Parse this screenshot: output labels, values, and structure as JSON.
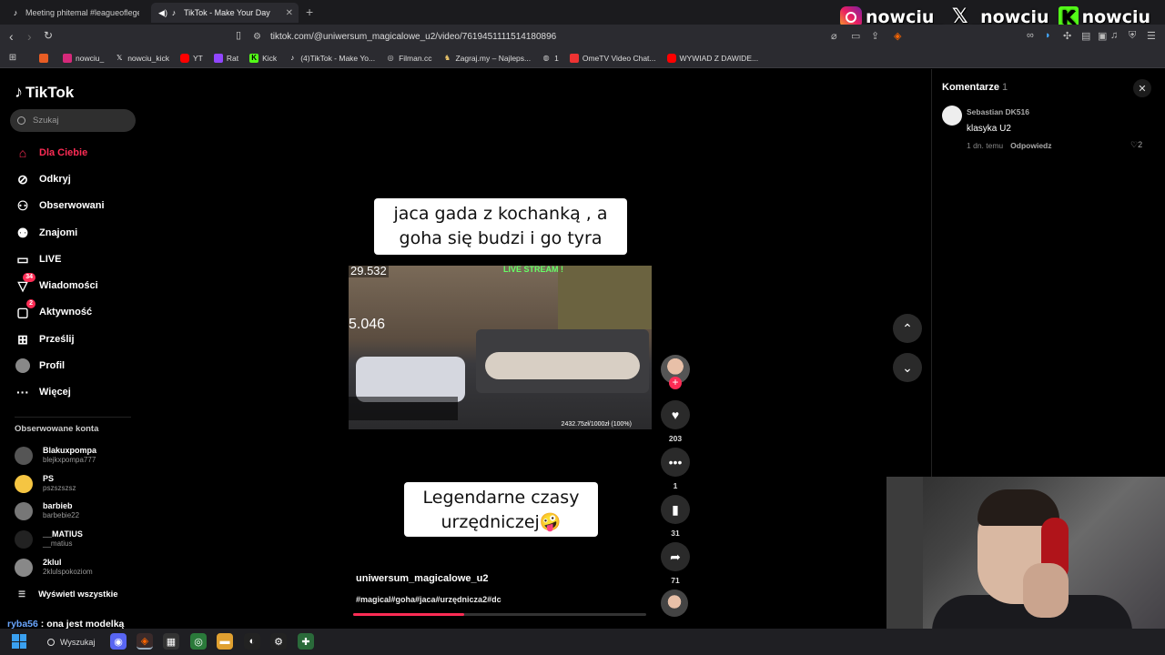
{
  "browser": {
    "tabs": [
      {
        "title": "Meeting phitemal #leagueoflegends"
      },
      {
        "title": "TikTok - Make Your Day"
      }
    ],
    "url": "tiktok.com/@uniwersum_magicalowe_u2/video/7619451111514180896",
    "bookmarks": [
      {
        "label": "nowciu_",
        "icon": "instagram-icon"
      },
      {
        "label": "nowciu_kick",
        "icon": "x-icon"
      },
      {
        "label": "YT",
        "icon": "youtube-icon"
      },
      {
        "label": "Rat",
        "icon": "twitch-icon"
      },
      {
        "label": "Kick",
        "icon": "kick-icon"
      },
      {
        "label": "(4)TikTok - Make Yo...",
        "icon": "tiktok-icon"
      },
      {
        "label": "Filman.cc",
        "icon": "filman-icon"
      },
      {
        "label": "Zagraj.my – Najleps...",
        "icon": "zagraj-icon"
      },
      {
        "label": "1",
        "icon": "globe-icon"
      },
      {
        "label": "OmeTV Video Chat...",
        "icon": "ometv-icon"
      },
      {
        "label": "WYWIAD Z DAWIDE...",
        "icon": "youtube-icon"
      }
    ]
  },
  "stream_overlay": {
    "ig_handle": "nowciu_",
    "x_handle": "_nowciu",
    "kick_handle": "nowciu"
  },
  "tiktok": {
    "logo": "TikTok",
    "search_placeholder": "Szukaj",
    "nav": [
      {
        "label": "Dla Ciebie",
        "icon": "home-icon",
        "active": true
      },
      {
        "label": "Odkryj",
        "icon": "compass-icon"
      },
      {
        "label": "Obserwowani",
        "icon": "following-icon"
      },
      {
        "label": "Znajomi",
        "icon": "friends-icon"
      },
      {
        "label": "LIVE",
        "icon": "live-icon"
      },
      {
        "label": "Wiadomości",
        "icon": "messages-icon",
        "badge": "34"
      },
      {
        "label": "Aktywność",
        "icon": "activity-icon",
        "badge": "2"
      },
      {
        "label": "Prześlij",
        "icon": "upload-icon"
      },
      {
        "label": "Profil",
        "icon": "profile-icon"
      },
      {
        "label": "Więcej",
        "icon": "more-icon"
      }
    ],
    "followed_title": "Obserwowane konta",
    "followed": [
      {
        "name": "Blakuxpompa",
        "handle": "blejkxpompa777"
      },
      {
        "name": "PS",
        "handle": "pszszszsz"
      },
      {
        "name": "barbieb",
        "handle": "barbebie22"
      },
      {
        "name": "__MATIUS",
        "handle": "__matius"
      },
      {
        "name": "2klul",
        "handle": "2klulspokoziom"
      }
    ],
    "show_all": "Wyświetl wszystkie"
  },
  "video": {
    "caption_top": "jaca gada z kochanką , a goha się budzi i go tyra",
    "caption_bottom": "Legendarne czasy urzędniczej🤪",
    "author": "uniwersum_magicalowe_u2",
    "hashtags": "#magical#goha#jaca#urzędnicza2#dc",
    "progress": 0.38,
    "embedded": {
      "viewers": "29.532",
      "count2": "5.046",
      "live_banner": "LIVE STREAM !",
      "goal": "2432.75zł/1000zł (100%)"
    },
    "likes": "203",
    "comments": "1",
    "saves": "31",
    "shares": "71"
  },
  "comments_panel": {
    "title": "Komentarze",
    "count": "1",
    "items": [
      {
        "user": "Sebastian DK516",
        "text": "klasyka U2",
        "time": "1 dn. temu",
        "reply": "Odpowiedz",
        "likes": "2"
      }
    ]
  },
  "chat": {
    "user": "ryba56",
    "message": ": ona jest modelką"
  },
  "taskbar": {
    "search": "Wyszukaj"
  },
  "colors": {
    "accent": "#fe2c55",
    "kick": "#53fc18"
  }
}
